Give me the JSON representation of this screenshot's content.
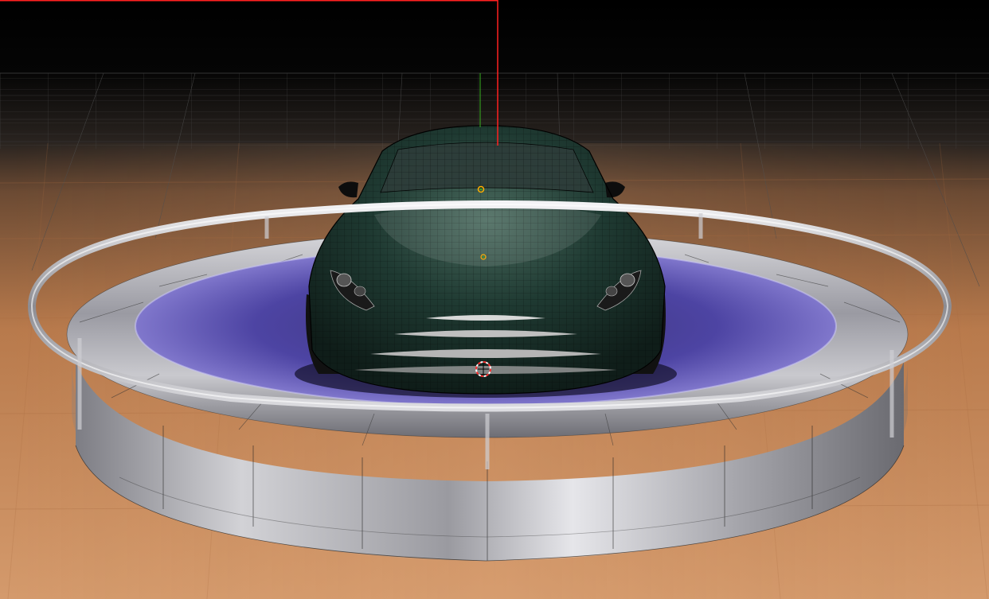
{
  "viewport": {
    "background_color": "#000000",
    "floor_color": "#c98a5a",
    "grid_color": "#5a5a5a",
    "platform_color": "#b8b8bc",
    "platform_inner_color": "#4b3f9c",
    "car_body_color": "#1f3a32",
    "wireframe_color": "#000000",
    "axis_x_color": "#ff2020",
    "axis_y_color": "#38b020",
    "cursor_color": "#ff3030"
  },
  "icons": {
    "origin_marker_1": "origin-dot-icon",
    "origin_marker_2": "origin-dot-icon",
    "cursor": "3d-cursor-icon"
  }
}
